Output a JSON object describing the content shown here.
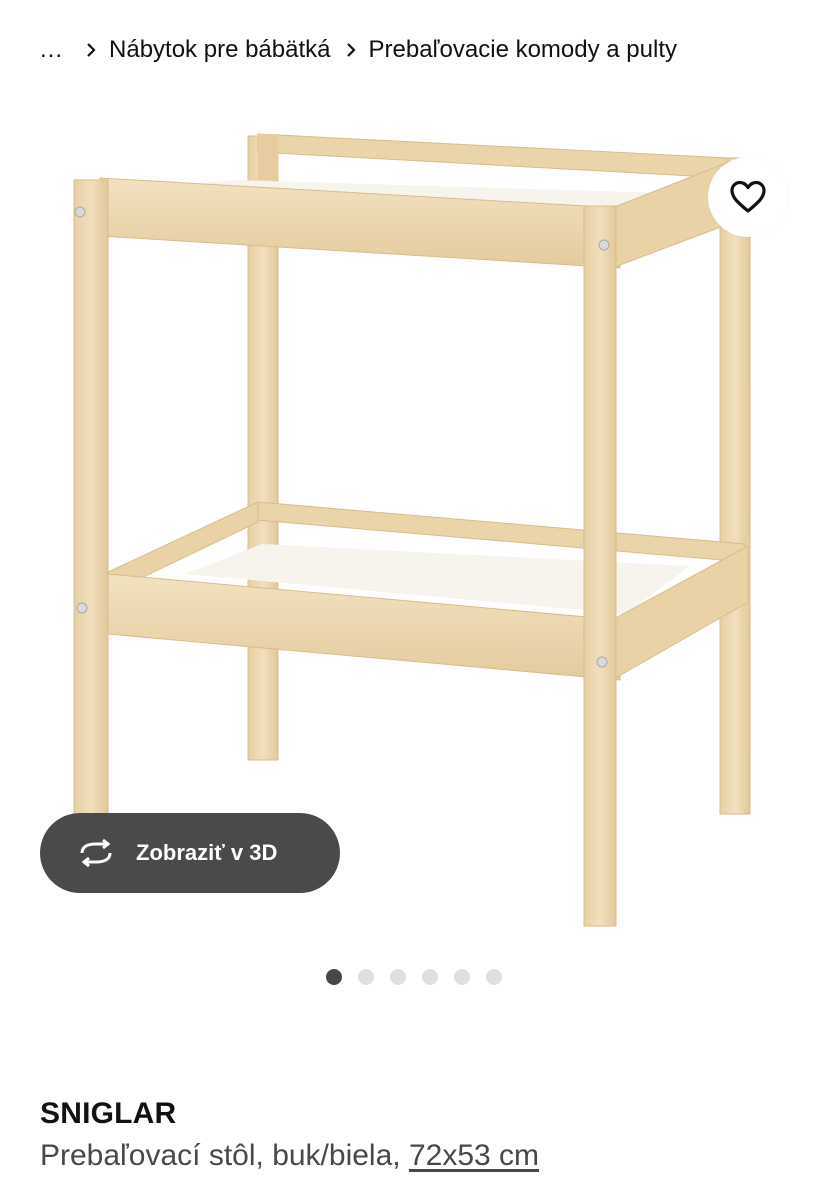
{
  "breadcrumb": {
    "ellipsis": "...",
    "items": [
      {
        "label": "Nábytok pre bábätká"
      },
      {
        "label": "Prebaľovacie komody a pulty"
      }
    ]
  },
  "gallery": {
    "image_alt": "Prebaľovací stôl, buk/biela",
    "favourite_icon": "heart-icon",
    "view_3d": {
      "label": "Zobraziť v 3D",
      "icon": "rotate-3d-icon"
    },
    "slide_count": 6,
    "active_slide": 1
  },
  "product": {
    "name": "SNIGLAR",
    "description": "Prebaľovací stôl, buk/biela, ",
    "size": "72x53 cm"
  },
  "colors": {
    "wood": "#ecd7b0",
    "button_dark": "#4a4a4a",
    "dot_active": "#484848",
    "dot_inactive": "#dfdfdf"
  }
}
